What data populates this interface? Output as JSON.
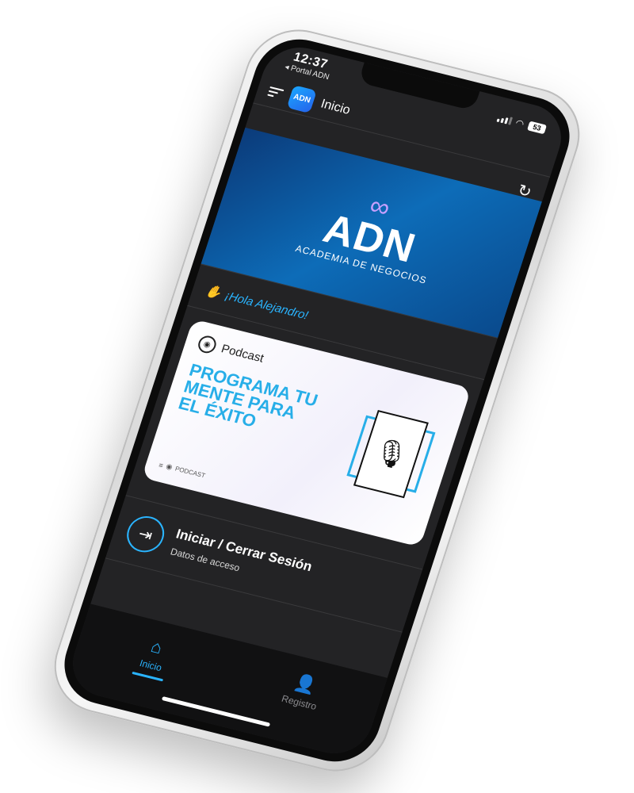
{
  "status": {
    "time": "12:37",
    "back_app": "◂ Portal ADN",
    "battery": "53"
  },
  "header": {
    "logo_text": "ADN",
    "title": "Inicio"
  },
  "banner": {
    "title": "ADN",
    "subtitle": "ACADEMIA DE NEGOCIOS"
  },
  "greeting": "¡Hola Alejandro!",
  "podcast_card": {
    "label": "Podcast",
    "headline": "PROGRAMA TU MENTE PARA EL ÉXITO",
    "footer": "PODCAST"
  },
  "session": {
    "title": "Iniciar / Cerrar Sesión",
    "subtitle": "Datos de acceso"
  },
  "nav": {
    "items": [
      {
        "label": "Inicio",
        "icon": "home-icon",
        "active": true
      },
      {
        "label": "Registro",
        "icon": "add-user-icon",
        "active": false
      }
    ]
  },
  "colors": {
    "accent": "#2ab4ff",
    "background": "#232325",
    "card_headline": "#27aee8"
  }
}
